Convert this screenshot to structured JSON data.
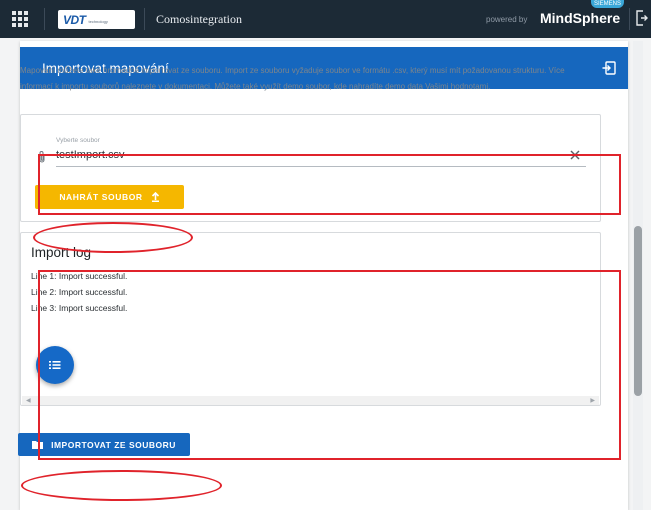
{
  "header": {
    "logo_text": "VDT",
    "logo_sub": "technology",
    "app_title": "Comosintegration",
    "powered_by": "powered by",
    "brand": "MindSphere",
    "brand_badge": "SIEMENS",
    "icons": [
      "apps-grid-icon",
      "exit-icon"
    ]
  },
  "panel": {
    "title": "Importovat mapování",
    "title_icon": "import-icon",
    "description": "Mapování můžete také hromadně importovat ze souboru. Import ze souboru vyžaduje soubor ve formátu .csv, který musí mít požadovanou strukturu. Více informací k importu souborů naleznete v dokumentaci. Můžete také využít demo soubor, kde nahradíte demo data Vašimi hodnotami."
  },
  "file_input": {
    "label": "Vyberte soubor",
    "value": "testImport.csv",
    "icons": [
      "paperclip-icon",
      "close-icon"
    ]
  },
  "upload_button": {
    "label": "NAHRÁT SOUBOR",
    "icon": "upload-arrow-icon"
  },
  "log": {
    "title": "Import log",
    "lines": [
      "Line 1: Import successful.",
      "Line 2: Import successful.",
      "Line 3: Import successful."
    ],
    "fab_icon": "list-icon"
  },
  "import_button": {
    "label": "IMPORTOVAT ZE SOUBORU",
    "icon": "folder-icon"
  },
  "colors": {
    "topbar": "#1c2a36",
    "primary": "#1667be",
    "accent_yellow": "#f5b700",
    "highlight_red": "#e0232b"
  }
}
